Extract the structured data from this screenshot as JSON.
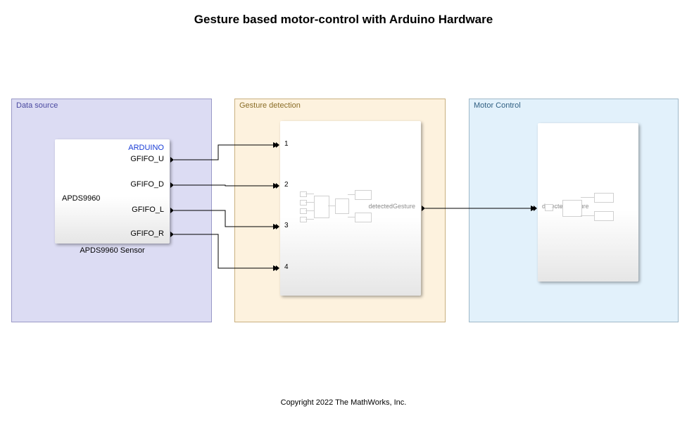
{
  "title": "Gesture based motor-control with Arduino Hardware",
  "footer": "Copyright 2022 The MathWorks, Inc.",
  "regions": {
    "data_source": {
      "label": "Data source"
    },
    "gesture_detection": {
      "label": "Gesture detection"
    },
    "motor_control": {
      "label": "Motor Control"
    }
  },
  "apds_block": {
    "vendor": "ARDUINO",
    "chip": "APDS9960",
    "label_below": "APDS9960 Sensor",
    "ports": {
      "u": "GFIFO_U",
      "d": "GFIFO_D",
      "l": "GFIFO_L",
      "r": "GFIFO_R"
    }
  },
  "gesture_block": {
    "in_ports": [
      "1",
      "2",
      "3",
      "4"
    ],
    "out_port_label": "detectedGesture"
  },
  "motor_block": {
    "in_port_label": "detectedGesture"
  }
}
